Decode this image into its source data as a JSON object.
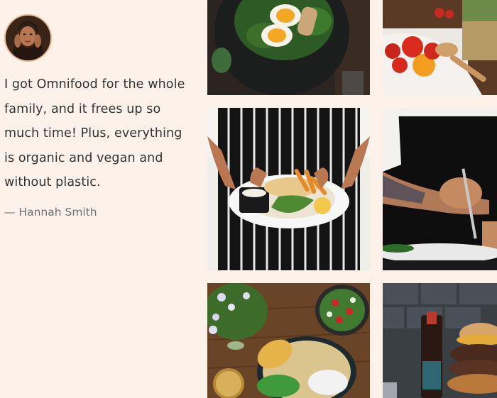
{
  "testimonial": {
    "quote": "I got Omnifood for the whole family, and it frees up so much time! Plus, everything is organic and vegan and without plastic.",
    "author": "— Hannah Smith"
  },
  "gallery": {
    "images": [
      "salad-with-eggs",
      "fresh-tomatoes",
      "chef-serving-plate",
      "chef-plating-food",
      "chickpea-bowl",
      "burger"
    ]
  }
}
